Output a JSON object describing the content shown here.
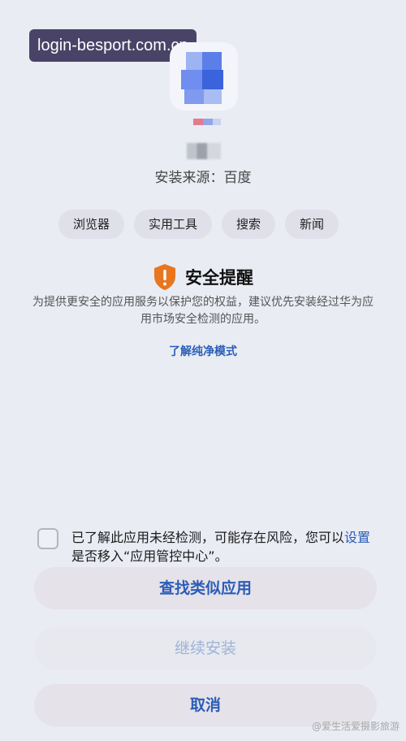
{
  "browser_overlay": {
    "url": "login-besport.com.cn"
  },
  "app": {
    "icon_name": "app-icon",
    "source_label": "安装来源：百度"
  },
  "tags": [
    "浏览器",
    "实用工具",
    "搜索",
    "新闻"
  ],
  "security": {
    "icon_name": "shield-warning-icon",
    "title": "安全提醒",
    "description": "为提供更安全的应用服务以保护您的权益，建议优先安装经过华为应用市场安全检测的应用。",
    "learn_more": "了解纯净模式"
  },
  "consent": {
    "checked": false,
    "text_before": "已了解此应用未经检测，可能存在风险，您可以",
    "link": "设置",
    "text_after": "是否移入“应用管控中心”。"
  },
  "buttons": {
    "find_similar": "查找类似应用",
    "continue_install": "继续安装",
    "cancel": "取消"
  },
  "watermark": "@爱生活爱摄影旅游",
  "colors": {
    "accent_blue": "#2b5db7",
    "warning_orange": "#e8761f",
    "overlay_purple": "#4a4368"
  }
}
